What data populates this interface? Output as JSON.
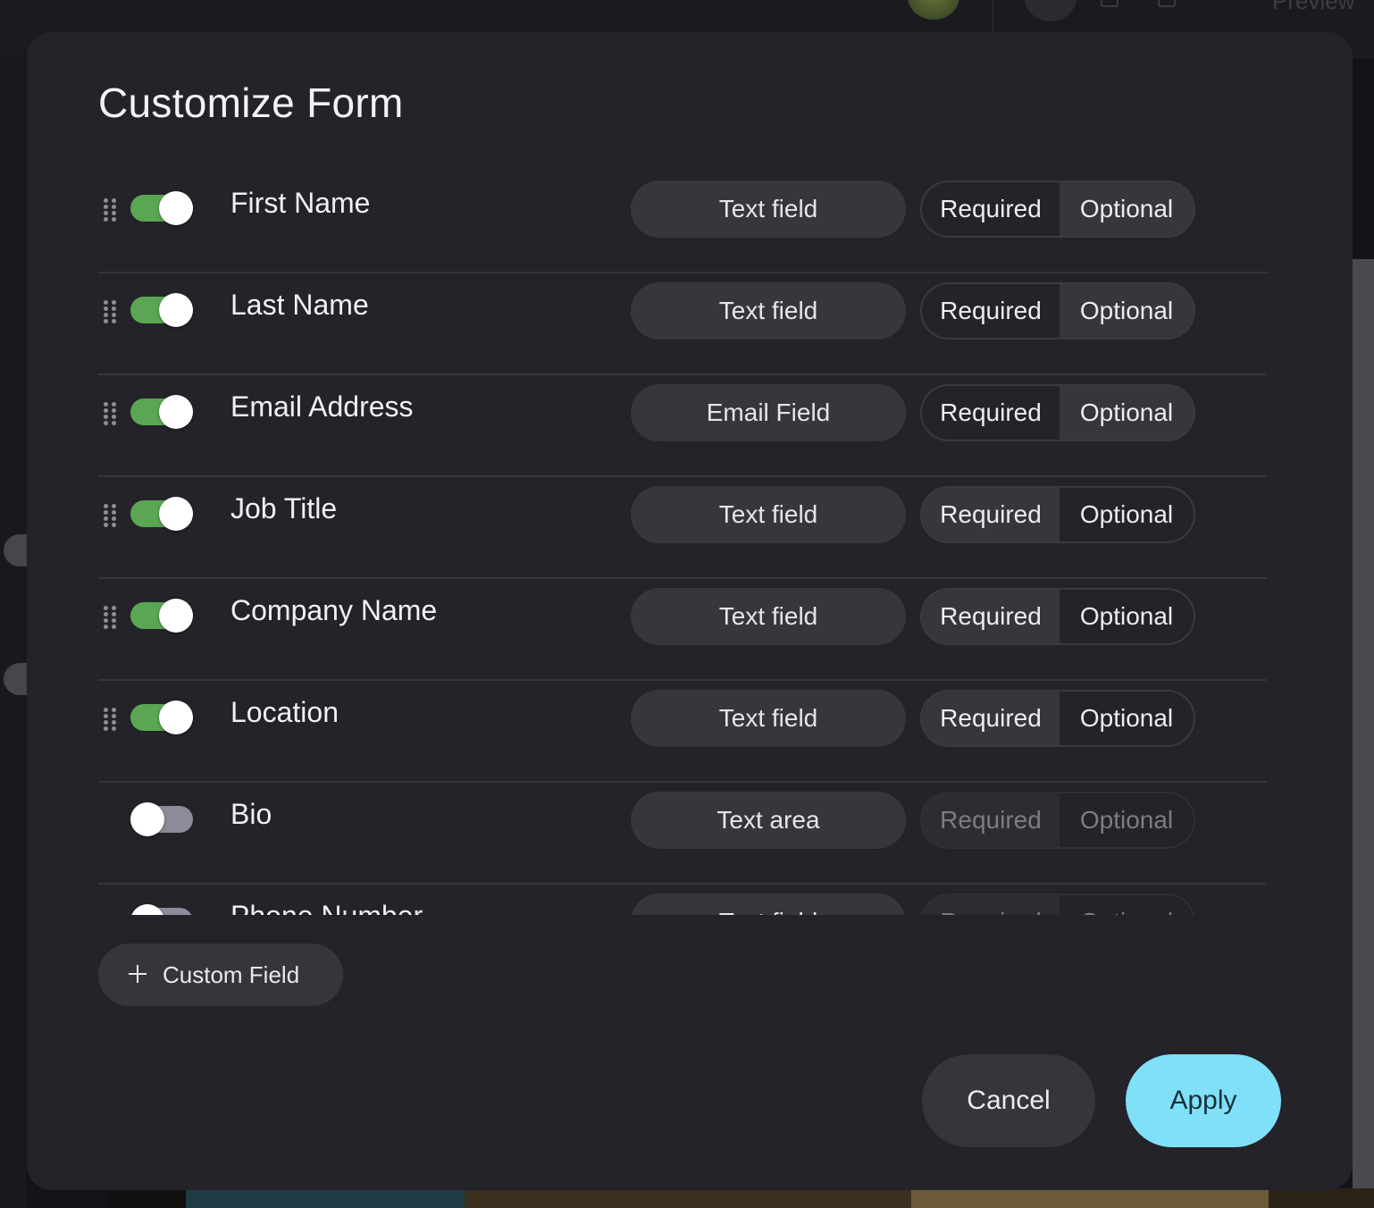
{
  "background": {
    "preview_label": "Preview"
  },
  "dialog": {
    "title": "Customize Form",
    "fields": [
      {
        "name": "First Name",
        "enabled": true,
        "type": "Text field",
        "requirement": "Optional",
        "draggable": true
      },
      {
        "name": "Last Name",
        "enabled": true,
        "type": "Text field",
        "requirement": "Optional",
        "draggable": true
      },
      {
        "name": "Email Address",
        "enabled": true,
        "type": "Email Field",
        "requirement": "Optional",
        "draggable": true
      },
      {
        "name": "Job Title",
        "enabled": true,
        "type": "Text field",
        "requirement": "Required",
        "draggable": true
      },
      {
        "name": "Company Name",
        "enabled": true,
        "type": "Text field",
        "requirement": "Required",
        "draggable": true
      },
      {
        "name": "Location",
        "enabled": true,
        "type": "Text field",
        "requirement": "Required",
        "draggable": true
      },
      {
        "name": "Bio",
        "enabled": false,
        "type": "Text area",
        "requirement": "Required",
        "draggable": false
      },
      {
        "name": "Phone Number",
        "enabled": false,
        "type": "Text field",
        "requirement": "Required",
        "draggable": false
      }
    ],
    "required_label": "Required",
    "optional_label": "Optional",
    "custom_field_label": "Custom Field",
    "cancel_label": "Cancel",
    "apply_label": "Apply"
  },
  "colors": {
    "toggle_on": "#5aa652",
    "toggle_off": "#8d8b99",
    "apply_accent": "#7fe0f8"
  }
}
